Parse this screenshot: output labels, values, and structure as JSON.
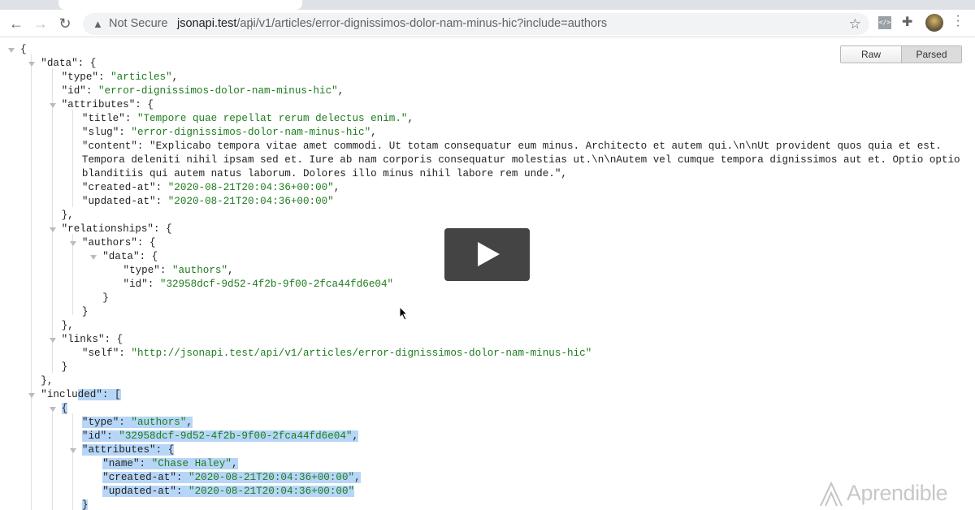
{
  "browser": {
    "security_label": "Not Secure",
    "url_host": "jsonapi.test",
    "url_path": "/api/v1/articles/error-dignissimos-dolor-nam-minus-hic?include=authors"
  },
  "viewer": {
    "raw_label": "Raw",
    "parsed_label": "Parsed"
  },
  "json_lines": [
    {
      "indent": 0,
      "toggle": true,
      "text": "{"
    },
    {
      "indent": 1,
      "toggle": true,
      "key": "data",
      "tail": ": {"
    },
    {
      "indent": 2,
      "key": "type",
      "val": "articles",
      "tail": ","
    },
    {
      "indent": 2,
      "key": "id",
      "val": "error-dignissimos-dolor-nam-minus-hic",
      "tail": ","
    },
    {
      "indent": 2,
      "toggle": true,
      "key": "attributes",
      "tail": ": {"
    },
    {
      "indent": 3,
      "key": "title",
      "val": "Tempore quae repellat rerum delectus enim.",
      "tail": ","
    },
    {
      "indent": 3,
      "key": "slug",
      "val": "error-dignissimos-dolor-nam-minus-hic",
      "tail": ","
    },
    {
      "indent": 3,
      "key": "content",
      "val": "Explicabo tempora vitae amet commodi. Ut totam consequatur eum minus. Architecto et autem qui.\\n\\nUt provident quos quia et est. Tempora deleniti nihil ipsam sed et. Iure ab nam corporis consequatur molestias ut.\\n\\nAutem vel cumque tempora dignissimos aut et. Optio optio blanditiis qui autem natus laborum. Dolores illo minus nihil labore rem unde.",
      "tail": ",",
      "wrap": 3
    },
    {
      "indent": 3,
      "key": "created-at",
      "val": "2020-08-21T20:04:36+00:00",
      "tail": ","
    },
    {
      "indent": 3,
      "key": "updated-at",
      "val": "2020-08-21T20:04:36+00:00"
    },
    {
      "indent": 2,
      "text": "},"
    },
    {
      "indent": 2,
      "toggle": true,
      "key": "relationships",
      "tail": ": {"
    },
    {
      "indent": 3,
      "toggle": true,
      "key": "authors",
      "tail": ": {"
    },
    {
      "indent": 4,
      "toggle": true,
      "key": "data",
      "tail": ": {"
    },
    {
      "indent": 5,
      "key": "type",
      "val": "authors",
      "tail": ","
    },
    {
      "indent": 5,
      "key": "id",
      "val": "32958dcf-9d52-4f2b-9f00-2fca44fd6e04"
    },
    {
      "indent": 4,
      "text": "}"
    },
    {
      "indent": 3,
      "text": "}"
    },
    {
      "indent": 2,
      "text": "},"
    },
    {
      "indent": 2,
      "toggle": true,
      "key": "links",
      "tail": ": {"
    },
    {
      "indent": 3,
      "key": "self",
      "val": "http://jsonapi.test/api/v1/articles/error-dignissimos-dolor-nam-minus-hic"
    },
    {
      "indent": 2,
      "text": "}"
    },
    {
      "indent": 1,
      "text": "},"
    },
    {
      "indent": 1,
      "toggle": true,
      "key": "included",
      "tail": ": [",
      "partial": true
    },
    {
      "indent": 2,
      "toggle": true,
      "text": "{",
      "hl": true
    },
    {
      "indent": 3,
      "key": "type",
      "val": "authors",
      "tail": ",",
      "hl": true
    },
    {
      "indent": 3,
      "key": "id",
      "val": "32958dcf-9d52-4f2b-9f00-2fca44fd6e04",
      "tail": ",",
      "hl": true
    },
    {
      "indent": 3,
      "toggle": true,
      "key": "attributes",
      "tail": ": {",
      "hl": true
    },
    {
      "indent": 4,
      "key": "name",
      "val": "Chase Haley",
      "tail": ",",
      "hl": true
    },
    {
      "indent": 4,
      "key": "created-at",
      "val": "2020-08-21T20:04:36+00:00",
      "tail": ",",
      "hl": true
    },
    {
      "indent": 4,
      "key": "updated-at",
      "val": "2020-08-21T20:04:36+00:00",
      "hl": true
    },
    {
      "indent": 3,
      "text": "}",
      "hl": true
    }
  ],
  "watermark": "Aprendible"
}
